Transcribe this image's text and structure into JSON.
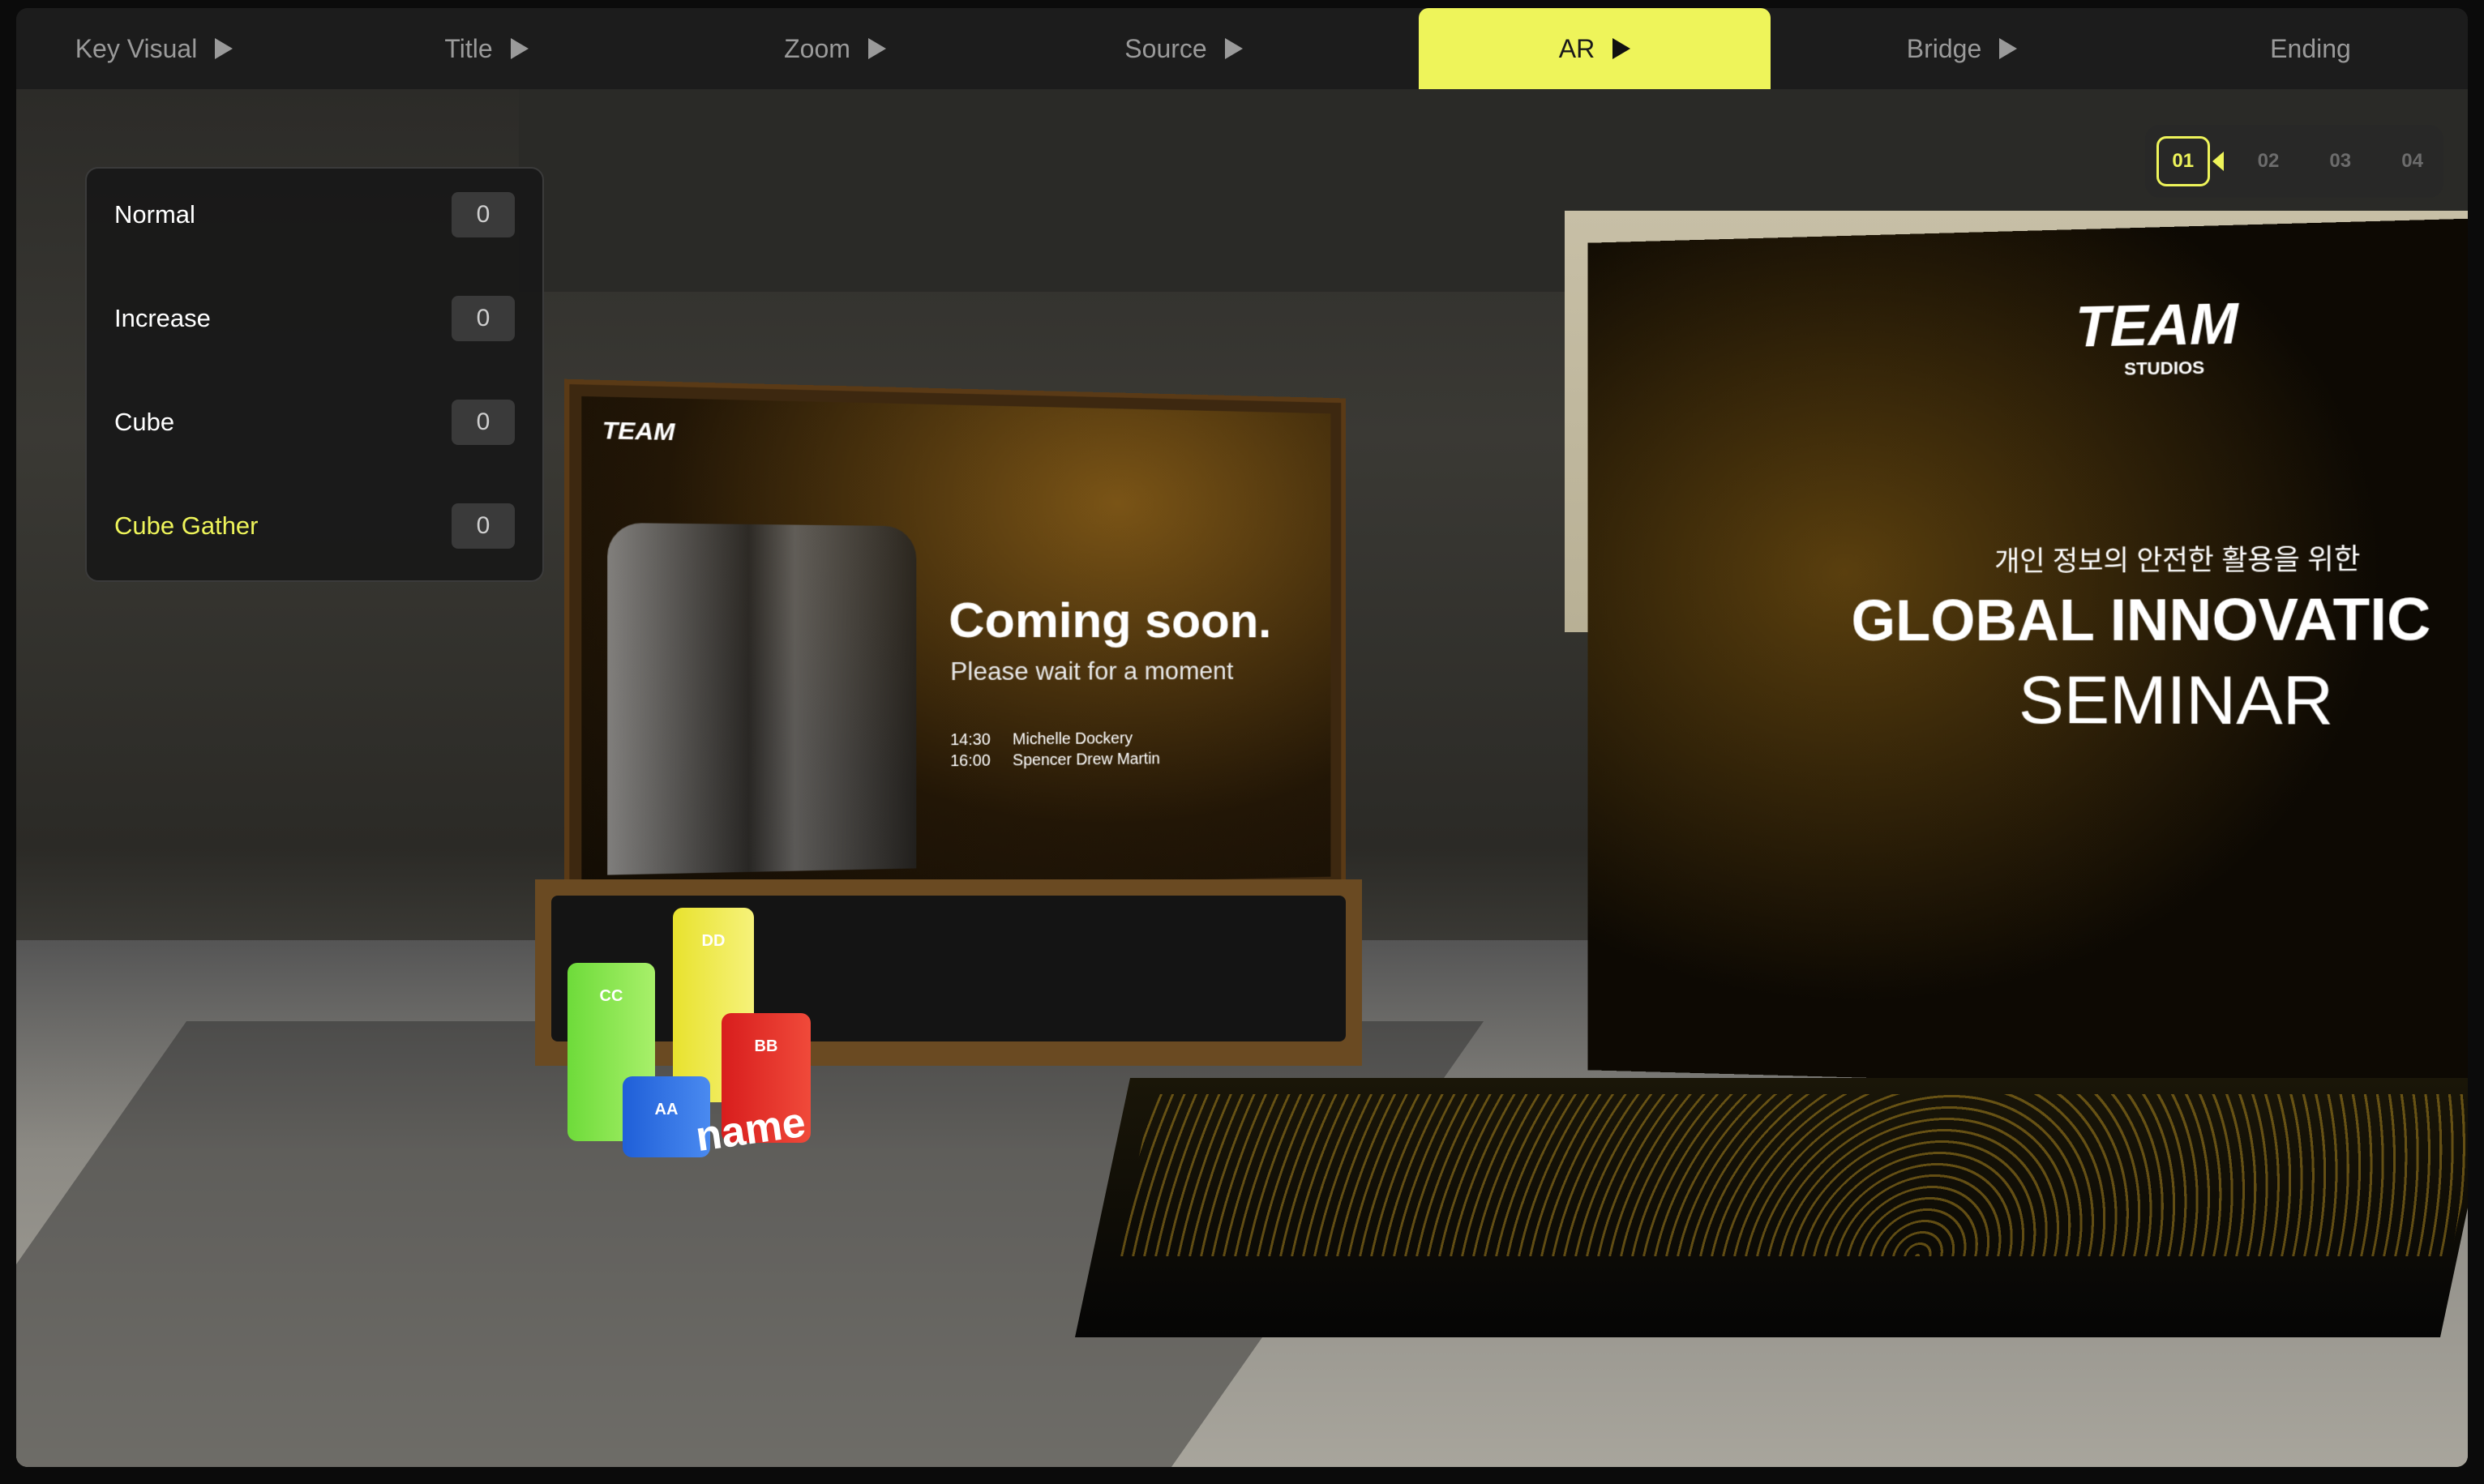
{
  "nav": {
    "tabs": [
      {
        "label": "Key Visual"
      },
      {
        "label": "Title"
      },
      {
        "label": "Zoom"
      },
      {
        "label": "Source"
      },
      {
        "label": "AR"
      },
      {
        "label": "Bridge"
      },
      {
        "label": "Ending"
      }
    ],
    "active_tab": "AR"
  },
  "panel": {
    "rows": [
      {
        "label": "Normal",
        "count": "0"
      },
      {
        "label": "Increase",
        "count": "0"
      },
      {
        "label": "Cube",
        "count": "0"
      },
      {
        "label": "Cube Gather",
        "count": "0"
      }
    ]
  },
  "cameras": {
    "items": [
      "01",
      "02",
      "03",
      "04"
    ],
    "active": "01"
  },
  "scene": {
    "left_screen": {
      "logo": "TEAM",
      "title": "Coming soon.",
      "subtitle": "Please wait for a moment",
      "schedule": [
        {
          "time": "14:30",
          "name": "Michelle Dockery"
        },
        {
          "time": "16:00",
          "name": "Spencer Drew Martin"
        }
      ]
    },
    "right_screen": {
      "logo": "TEAM",
      "logo_sub": "STUDIOS",
      "korean_line": "개인 정보의 안전한 활용을 위한",
      "headline": "GLOBAL INNOVATIC",
      "subheadline": "SEMINAR"
    },
    "cubes": {
      "labels": [
        "CC",
        "DD",
        "AA",
        "BB"
      ],
      "caption": "name"
    }
  },
  "colors": {
    "accent": "#eef45a",
    "panel_bg": "#181818"
  }
}
